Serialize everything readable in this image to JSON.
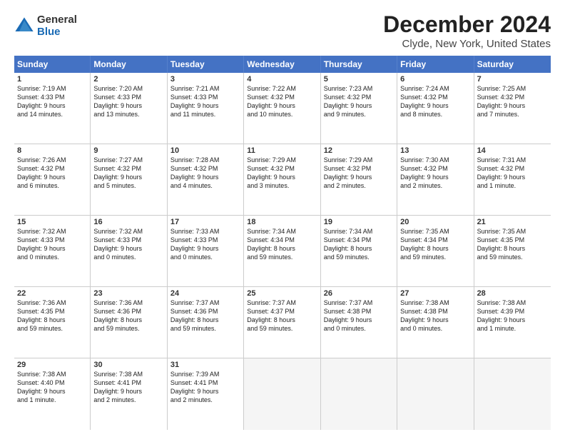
{
  "header": {
    "logo_line1": "General",
    "logo_line2": "Blue",
    "title": "December 2024",
    "subtitle": "Clyde, New York, United States"
  },
  "day_names": [
    "Sunday",
    "Monday",
    "Tuesday",
    "Wednesday",
    "Thursday",
    "Friday",
    "Saturday"
  ],
  "weeks": [
    [
      {
        "num": "1",
        "lines": [
          "Sunrise: 7:19 AM",
          "Sunset: 4:33 PM",
          "Daylight: 9 hours",
          "and 14 minutes."
        ]
      },
      {
        "num": "2",
        "lines": [
          "Sunrise: 7:20 AM",
          "Sunset: 4:33 PM",
          "Daylight: 9 hours",
          "and 13 minutes."
        ]
      },
      {
        "num": "3",
        "lines": [
          "Sunrise: 7:21 AM",
          "Sunset: 4:33 PM",
          "Daylight: 9 hours",
          "and 11 minutes."
        ]
      },
      {
        "num": "4",
        "lines": [
          "Sunrise: 7:22 AM",
          "Sunset: 4:32 PM",
          "Daylight: 9 hours",
          "and 10 minutes."
        ]
      },
      {
        "num": "5",
        "lines": [
          "Sunrise: 7:23 AM",
          "Sunset: 4:32 PM",
          "Daylight: 9 hours",
          "and 9 minutes."
        ]
      },
      {
        "num": "6",
        "lines": [
          "Sunrise: 7:24 AM",
          "Sunset: 4:32 PM",
          "Daylight: 9 hours",
          "and 8 minutes."
        ]
      },
      {
        "num": "7",
        "lines": [
          "Sunrise: 7:25 AM",
          "Sunset: 4:32 PM",
          "Daylight: 9 hours",
          "and 7 minutes."
        ]
      }
    ],
    [
      {
        "num": "8",
        "lines": [
          "Sunrise: 7:26 AM",
          "Sunset: 4:32 PM",
          "Daylight: 9 hours",
          "and 6 minutes."
        ]
      },
      {
        "num": "9",
        "lines": [
          "Sunrise: 7:27 AM",
          "Sunset: 4:32 PM",
          "Daylight: 9 hours",
          "and 5 minutes."
        ]
      },
      {
        "num": "10",
        "lines": [
          "Sunrise: 7:28 AM",
          "Sunset: 4:32 PM",
          "Daylight: 9 hours",
          "and 4 minutes."
        ]
      },
      {
        "num": "11",
        "lines": [
          "Sunrise: 7:29 AM",
          "Sunset: 4:32 PM",
          "Daylight: 9 hours",
          "and 3 minutes."
        ]
      },
      {
        "num": "12",
        "lines": [
          "Sunrise: 7:29 AM",
          "Sunset: 4:32 PM",
          "Daylight: 9 hours",
          "and 2 minutes."
        ]
      },
      {
        "num": "13",
        "lines": [
          "Sunrise: 7:30 AM",
          "Sunset: 4:32 PM",
          "Daylight: 9 hours",
          "and 2 minutes."
        ]
      },
      {
        "num": "14",
        "lines": [
          "Sunrise: 7:31 AM",
          "Sunset: 4:32 PM",
          "Daylight: 9 hours",
          "and 1 minute."
        ]
      }
    ],
    [
      {
        "num": "15",
        "lines": [
          "Sunrise: 7:32 AM",
          "Sunset: 4:33 PM",
          "Daylight: 9 hours",
          "and 0 minutes."
        ]
      },
      {
        "num": "16",
        "lines": [
          "Sunrise: 7:32 AM",
          "Sunset: 4:33 PM",
          "Daylight: 9 hours",
          "and 0 minutes."
        ]
      },
      {
        "num": "17",
        "lines": [
          "Sunrise: 7:33 AM",
          "Sunset: 4:33 PM",
          "Daylight: 9 hours",
          "and 0 minutes."
        ]
      },
      {
        "num": "18",
        "lines": [
          "Sunrise: 7:34 AM",
          "Sunset: 4:34 PM",
          "Daylight: 8 hours",
          "and 59 minutes."
        ]
      },
      {
        "num": "19",
        "lines": [
          "Sunrise: 7:34 AM",
          "Sunset: 4:34 PM",
          "Daylight: 8 hours",
          "and 59 minutes."
        ]
      },
      {
        "num": "20",
        "lines": [
          "Sunrise: 7:35 AM",
          "Sunset: 4:34 PM",
          "Daylight: 8 hours",
          "and 59 minutes."
        ]
      },
      {
        "num": "21",
        "lines": [
          "Sunrise: 7:35 AM",
          "Sunset: 4:35 PM",
          "Daylight: 8 hours",
          "and 59 minutes."
        ]
      }
    ],
    [
      {
        "num": "22",
        "lines": [
          "Sunrise: 7:36 AM",
          "Sunset: 4:35 PM",
          "Daylight: 8 hours",
          "and 59 minutes."
        ]
      },
      {
        "num": "23",
        "lines": [
          "Sunrise: 7:36 AM",
          "Sunset: 4:36 PM",
          "Daylight: 8 hours",
          "and 59 minutes."
        ]
      },
      {
        "num": "24",
        "lines": [
          "Sunrise: 7:37 AM",
          "Sunset: 4:36 PM",
          "Daylight: 8 hours",
          "and 59 minutes."
        ]
      },
      {
        "num": "25",
        "lines": [
          "Sunrise: 7:37 AM",
          "Sunset: 4:37 PM",
          "Daylight: 8 hours",
          "and 59 minutes."
        ]
      },
      {
        "num": "26",
        "lines": [
          "Sunrise: 7:37 AM",
          "Sunset: 4:38 PM",
          "Daylight: 9 hours",
          "and 0 minutes."
        ]
      },
      {
        "num": "27",
        "lines": [
          "Sunrise: 7:38 AM",
          "Sunset: 4:38 PM",
          "Daylight: 9 hours",
          "and 0 minutes."
        ]
      },
      {
        "num": "28",
        "lines": [
          "Sunrise: 7:38 AM",
          "Sunset: 4:39 PM",
          "Daylight: 9 hours",
          "and 1 minute."
        ]
      }
    ],
    [
      {
        "num": "29",
        "lines": [
          "Sunrise: 7:38 AM",
          "Sunset: 4:40 PM",
          "Daylight: 9 hours",
          "and 1 minute."
        ]
      },
      {
        "num": "30",
        "lines": [
          "Sunrise: 7:38 AM",
          "Sunset: 4:41 PM",
          "Daylight: 9 hours",
          "and 2 minutes."
        ]
      },
      {
        "num": "31",
        "lines": [
          "Sunrise: 7:39 AM",
          "Sunset: 4:41 PM",
          "Daylight: 9 hours",
          "and 2 minutes."
        ]
      },
      {
        "num": "",
        "lines": []
      },
      {
        "num": "",
        "lines": []
      },
      {
        "num": "",
        "lines": []
      },
      {
        "num": "",
        "lines": []
      }
    ]
  ]
}
